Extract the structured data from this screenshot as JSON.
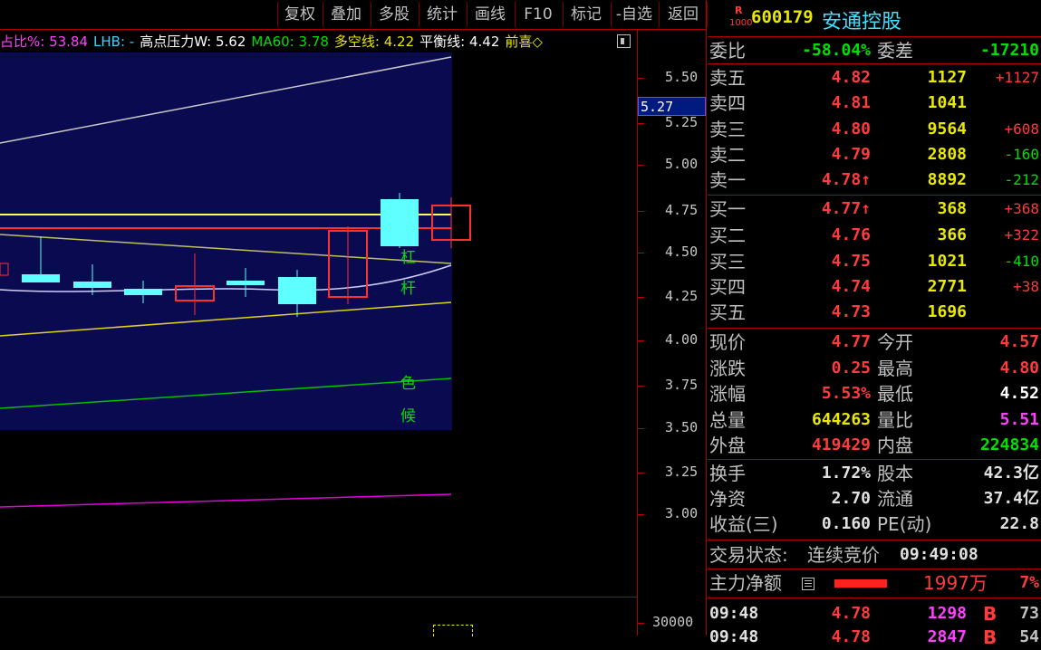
{
  "toolbar": {
    "items": [
      "复权",
      "叠加",
      "多股",
      "统计",
      "画线",
      "F10",
      "标记",
      "-自选",
      "返回"
    ]
  },
  "indicator_bar": {
    "ratio_label": "占比%: 53.84",
    "lhb_label": "LHB: -",
    "pressure_label": "高点压力W: 5.62",
    "ma60_label": "MA60: 3.78",
    "duokong_label": "多空线: 4.22",
    "pingheng_label": "平衡线: 4.42",
    "qianxi_label": "前喜◇"
  },
  "price_axis": {
    "ticks": [
      "5.50",
      "5.25",
      "5.00",
      "4.75",
      "4.50",
      "4.25",
      "4.00",
      "3.75",
      "3.50",
      "3.25",
      "3.00"
    ],
    "current_marker": "5.27",
    "volume_tick": "30000"
  },
  "chart_text": {
    "label_hong": "杠",
    "label_gan": "杆",
    "label_se": "色",
    "label_hou": "候"
  },
  "stock": {
    "badge_top": "R",
    "badge_bottom": "1000",
    "code": "600179",
    "name": "安通控股"
  },
  "weibi": {
    "label": "委比",
    "value": "-58.04%",
    "label2": "委差",
    "value2": "-17210"
  },
  "sell": [
    {
      "label": "卖五",
      "price": "4.82",
      "vol": "1127",
      "chg": "+1127"
    },
    {
      "label": "卖四",
      "price": "4.81",
      "vol": "1041",
      "chg": ""
    },
    {
      "label": "卖三",
      "price": "4.80",
      "vol": "9564",
      "chg": "+608"
    },
    {
      "label": "卖二",
      "price": "4.79",
      "vol": "2808",
      "chg": "-160"
    },
    {
      "label": "卖一",
      "price": "4.78↑",
      "vol": "8892",
      "chg": "-212"
    }
  ],
  "buy": [
    {
      "label": "买一",
      "price": "4.77↑",
      "vol": "368",
      "chg": "+368"
    },
    {
      "label": "买二",
      "price": "4.76",
      "vol": "366",
      "chg": "+322"
    },
    {
      "label": "买三",
      "price": "4.75",
      "vol": "1021",
      "chg": "-410"
    },
    {
      "label": "买四",
      "price": "4.74",
      "vol": "2771",
      "chg": "+38"
    },
    {
      "label": "买五",
      "price": "4.73",
      "vol": "1696",
      "chg": ""
    }
  ],
  "quote": [
    {
      "l1": "现价",
      "v1": "4.77",
      "l2": "今开",
      "v2": "4.57"
    },
    {
      "l1": "涨跌",
      "v1": "0.25",
      "l2": "最高",
      "v2": "4.80"
    },
    {
      "l1": "涨幅",
      "v1": "5.53%",
      "l2": "最低",
      "v2": "4.52"
    },
    {
      "l1": "总量",
      "v1": "644263",
      "l2": "量比",
      "v2": "5.51"
    },
    {
      "l1": "外盘",
      "v1": "419429",
      "l2": "内盘",
      "v2": "224834"
    }
  ],
  "stats": [
    {
      "l1": "换手",
      "v1": "1.72%",
      "l2": "股本",
      "v2": "42.3亿"
    },
    {
      "l1": "净资",
      "v1": "2.70",
      "l2": "流通",
      "v2": "37.4亿"
    },
    {
      "l1": "收益(三)",
      "v1": "0.160",
      "l2": "PE(动)",
      "v2": "22.8"
    }
  ],
  "trade_status": {
    "label": "交易状态:",
    "state": "连续竞价",
    "time": "09:49:08"
  },
  "main_force": {
    "label": "主力净额",
    "amount": "1997万",
    "pct": "7%"
  },
  "ticks": [
    {
      "time": "09:48",
      "price": "4.78",
      "vol": "1298",
      "side": "B",
      "count": "73"
    },
    {
      "time": "09:48",
      "price": "4.78",
      "vol": "2847",
      "side": "B",
      "count": "54"
    }
  ],
  "colors": {
    "up": "#ff3b3b",
    "down": "#00e000",
    "accent": "#e8e800",
    "chart_bg": "#0a0a50",
    "frame": "#b00000"
  }
}
